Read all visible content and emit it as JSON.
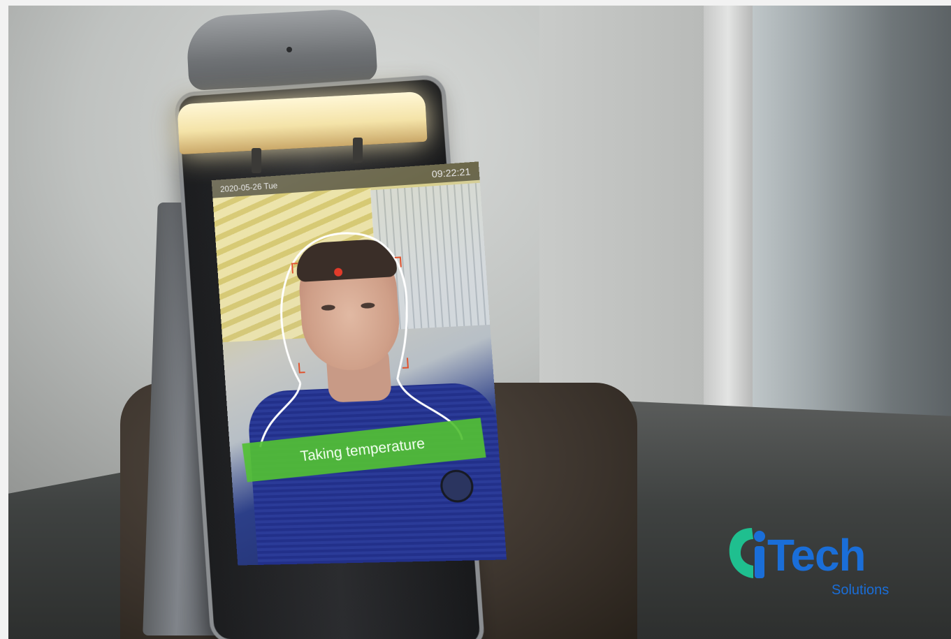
{
  "screen": {
    "date": "2020-05-26 Tue",
    "time": "09:22:21",
    "status_message": "Taking temperature"
  },
  "logo": {
    "wordmark": "iTech",
    "subtitle": "Solutions"
  },
  "colors": {
    "banner_green": "#52c034",
    "target_dot_red": "#e23b2a",
    "logo_blue": "#1a6ed8",
    "logo_green": "#1fbf8f"
  }
}
